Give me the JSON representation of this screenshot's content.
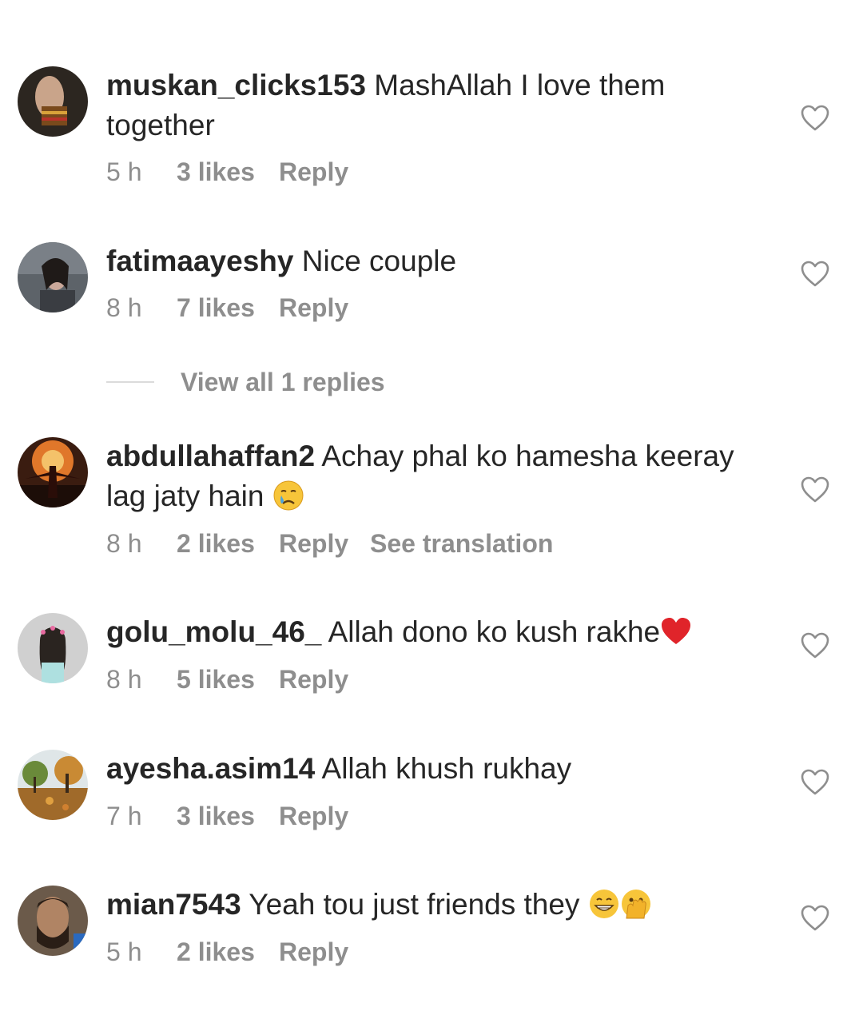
{
  "comments": [
    {
      "username": "muskan_clicks153",
      "text": "MashAllah I love them together",
      "time": "5 h",
      "likes": "3 likes",
      "reply": "Reply",
      "avatar_color": "#2c2620"
    },
    {
      "username": "fatimaayeshy",
      "text": "Nice couple",
      "time": "8 h",
      "likes": "7 likes",
      "reply": "Reply",
      "avatar_color": "#5d6369"
    },
    {
      "username": "abdullahaffan2",
      "text": "Achay phal ko hamesha keeray lag jaty hain",
      "time": "8 h",
      "likes": "2 likes",
      "reply": "Reply",
      "see_translation": "See translation",
      "emoji": "crying-face",
      "avatar_color": "#3a1c10"
    },
    {
      "username": "golu_molu_46_",
      "text": "Allah dono ko kush rakhe",
      "time": "8 h",
      "likes": "5 likes",
      "reply": "Reply",
      "emoji": "red-heart",
      "avatar_color": "#d0d0d0"
    },
    {
      "username": "ayesha.asim14",
      "text": "Allah khush rukhay",
      "time": "7 h",
      "likes": "3 likes",
      "reply": "Reply",
      "avatar_color": "#a06a2a"
    },
    {
      "username": "mian7543",
      "text": "Yeah tou just friends they",
      "time": "5 h",
      "likes": "2 likes",
      "reply": "Reply",
      "emoji": "grinning-face + face-with-open-eyes-and-hand-over-mouth",
      "avatar_color": "#6b5a4a"
    }
  ],
  "view_replies": "View all 1 replies",
  "colors": {
    "text": "#262626",
    "secondary": "#8e8e8e",
    "divider": "#dbdbdb"
  }
}
